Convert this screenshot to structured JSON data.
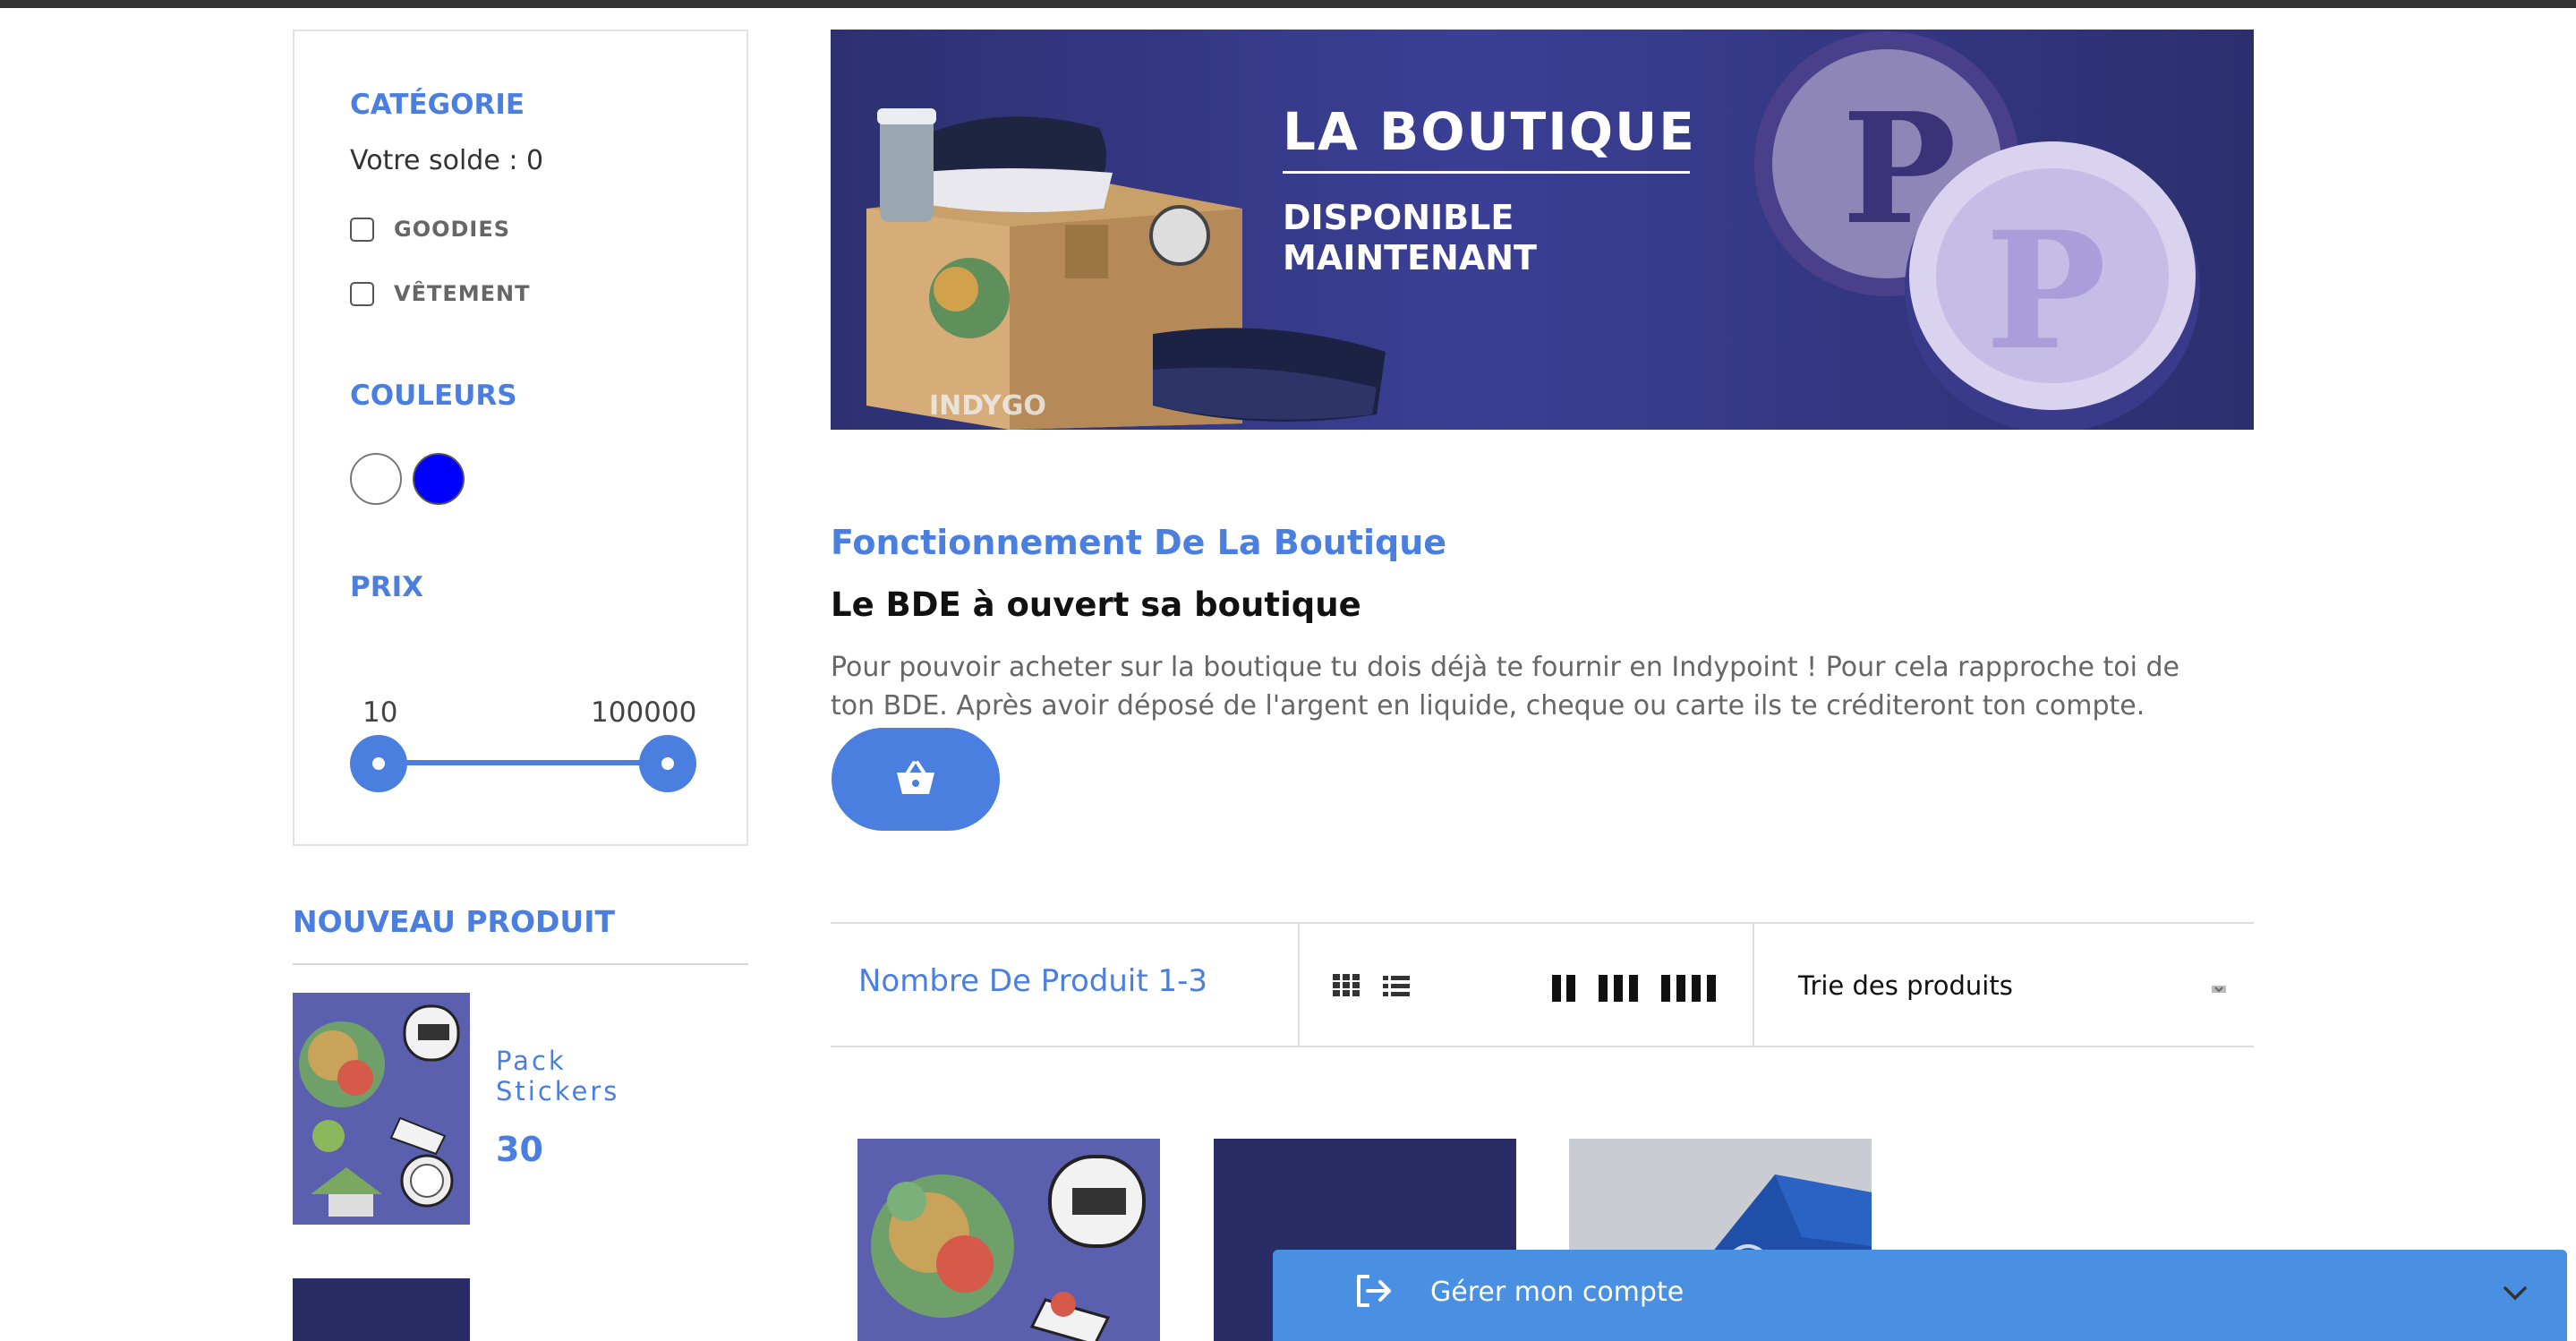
{
  "filters": {
    "category_title": "CATÉGORIE",
    "balance": "Votre solde : 0",
    "categories": [
      "GOODIES",
      "VÊTEMENT"
    ],
    "colors_title": "COULEURS",
    "colors": [
      "#ffffff",
      "#0000ff"
    ],
    "price_title": "PRIX",
    "price_min": "10",
    "price_max": "100000"
  },
  "new_product": {
    "title": "NOUVEAU PRODUIT",
    "name": "Pack Stickers",
    "price": "30"
  },
  "banner": {
    "title": "LA BOUTIQUE",
    "subtitle_line1": "DISPONIBLE",
    "subtitle_line2": "MAINTENANT",
    "brand": "INDYGO"
  },
  "main": {
    "section_title": "Fonctionnement De La Boutique",
    "heading": "Le BDE à ouvert sa boutique",
    "paragraph": "Pour pouvoir acheter sur la boutique tu dois déjà te fournir en Indypoint ! Pour cela rapproche toi de ton BDE. Après avoir déposé de l'argent en liquide, cheque ou carte ils te créditeront ton compte."
  },
  "toolbar": {
    "product_count": "Nombre De Produit 1-3",
    "sort_label": "Trie des produits"
  },
  "account": {
    "label": "Gérer mon compte"
  },
  "theme": {
    "accent": "#4a7fe0",
    "account_bar": "#4a90e2"
  }
}
